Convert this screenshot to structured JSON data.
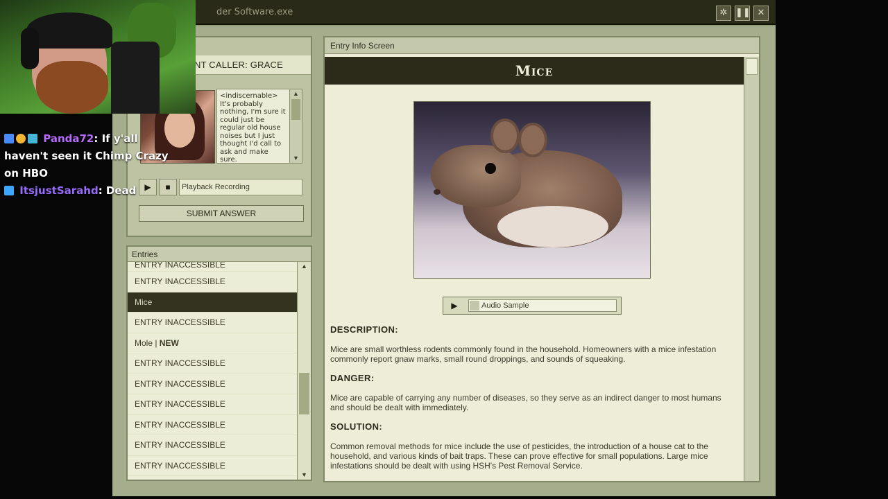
{
  "window": {
    "title": "der Software.exe",
    "controls": {
      "settings": "✲",
      "pause": "❚❚",
      "close": "✕"
    }
  },
  "caller": {
    "label": "NT CALLER: GRACE",
    "transcript": "<indiscernable> It's probably nothing, I'm sure it could just be regular old house noises but I just thought I'd call to ask and make sure.",
    "playback_placeholder": "Playback Recording",
    "submit_label": "SUBMIT ANSWER"
  },
  "entries": {
    "header": "Entries",
    "items": [
      {
        "label": "ENTRY INACCESSIBLE"
      },
      {
        "label": "ENTRY INACCESSIBLE"
      },
      {
        "label": "Mice",
        "selected": true
      },
      {
        "label": "ENTRY INACCESSIBLE"
      },
      {
        "label": "Mole | ",
        "badge": "NEW"
      },
      {
        "label": "ENTRY INACCESSIBLE"
      },
      {
        "label": "ENTRY INACCESSIBLE"
      },
      {
        "label": "ENTRY INACCESSIBLE"
      },
      {
        "label": "ENTRY INACCESSIBLE"
      },
      {
        "label": "ENTRY INACCESSIBLE"
      },
      {
        "label": "ENTRY INACCESSIBLE"
      }
    ]
  },
  "info": {
    "header": "Entry Info Screen",
    "title": "Mice",
    "audio_label": "Audio Sample",
    "description_heading": "DESCRIPTION:",
    "description": "Mice are small worthless rodents commonly found in the household. Homeowners with a mice infestation commonly report gnaw marks, small round droppings, and sounds of squeaking.",
    "danger_heading": "DANGER:",
    "danger": "Mice are capable of carrying any number of diseases, so they serve as an indirect danger to most humans and should be dealt with immediately.",
    "solution_heading": "SOLUTION:",
    "solution": "Common removal methods for mice include the use of pesticides, the introduction of a house cat to the household, and various kinds of bait traps. These can prove effective for small populations. Large mice infestations should be dealt with using HSH's Pest Removal Service."
  },
  "chat": [
    {
      "user": "Panda72",
      "message": ": If y'all haven't seen it Chimp Crazy on HBO"
    },
    {
      "user": "ItsjustSarahd",
      "message": ": Dead"
    }
  ],
  "colors": {
    "titlebar": "#2a2a18",
    "panel": "#eeeed8",
    "selected": "#333320",
    "chat_user": "#b86bff"
  }
}
